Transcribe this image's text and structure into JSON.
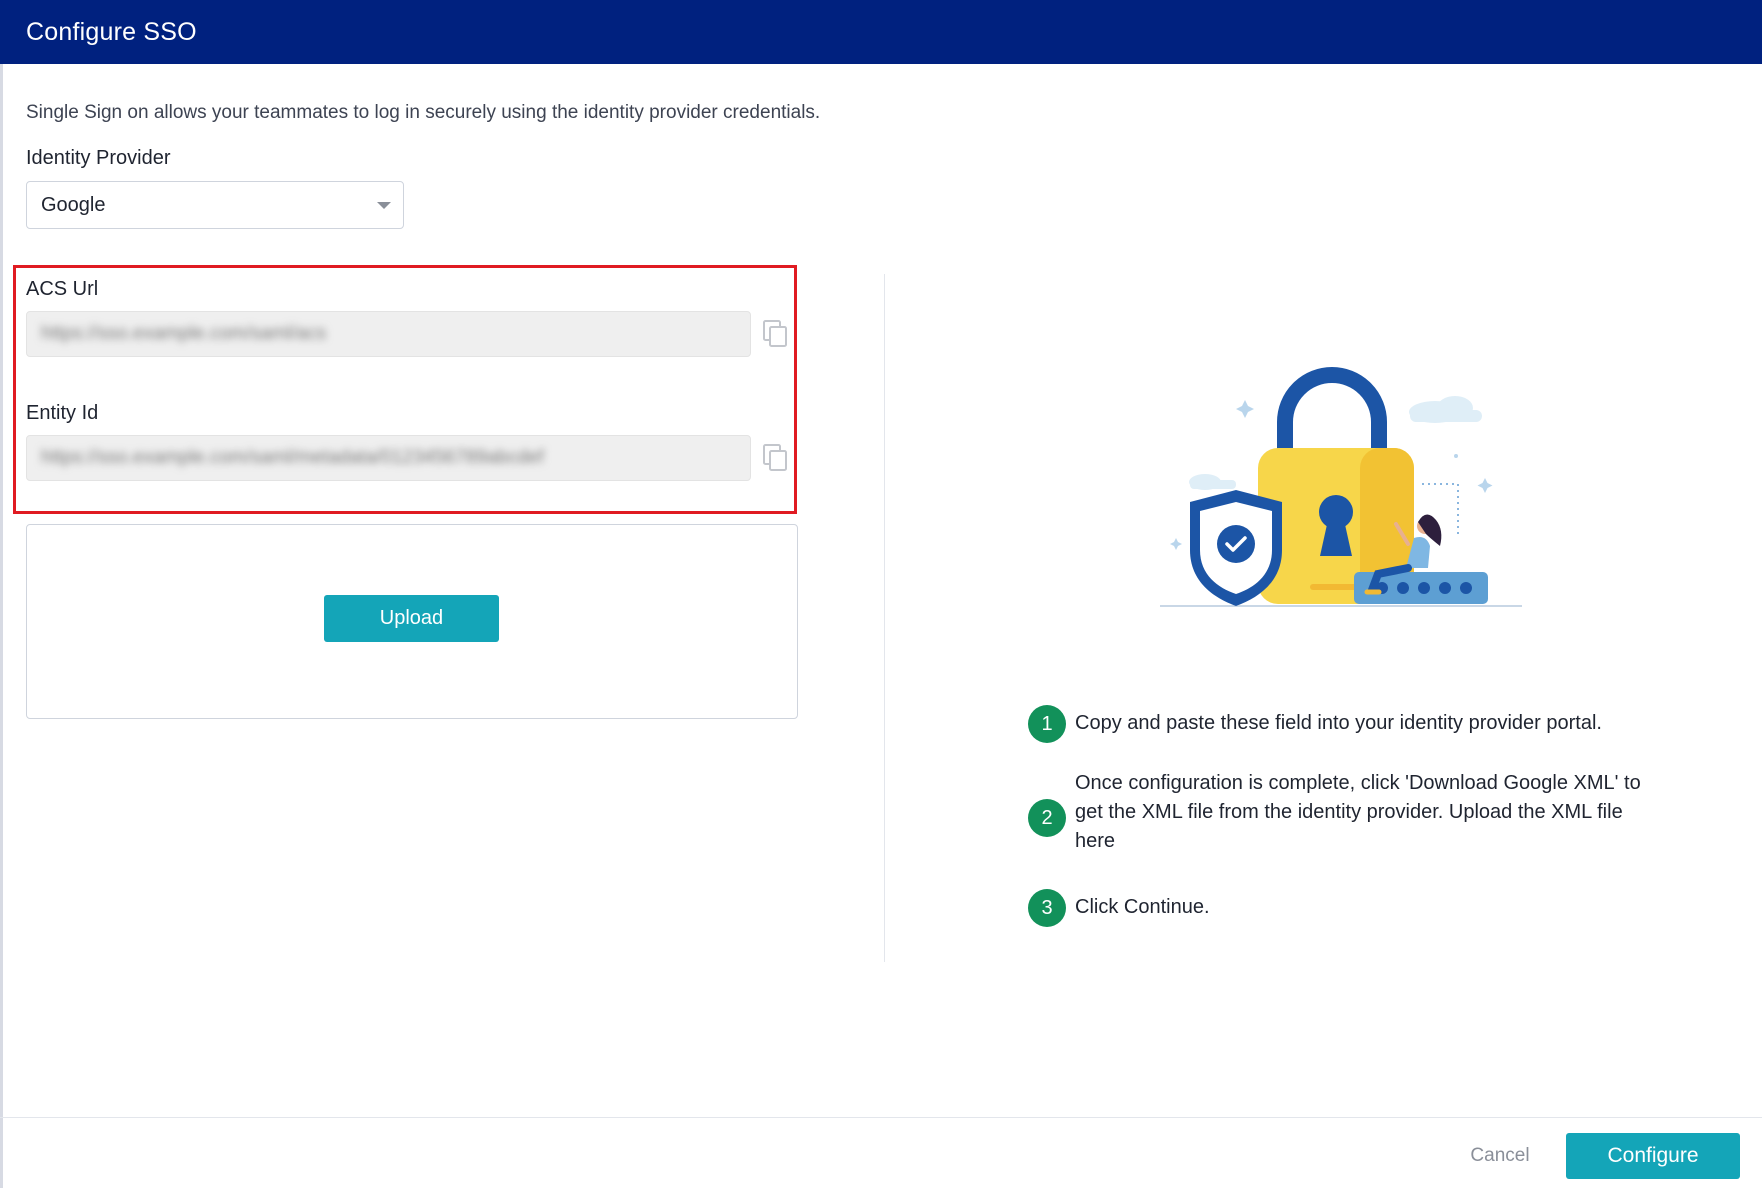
{
  "dialog": {
    "title": "Configure SSO",
    "intro": "Single Sign on allows your teammates to log in securely using the identity provider credentials."
  },
  "identity_provider": {
    "label": "Identity Provider",
    "selected": "Google"
  },
  "acs_url": {
    "label": "ACS Url",
    "value": "https://sso.example.com/saml/acs"
  },
  "entity_id": {
    "label": "Entity Id",
    "value": "https://sso.example.com/saml/metadata/0123456789abcdef"
  },
  "upload": {
    "button_label": "Upload"
  },
  "steps": [
    {
      "number": "1",
      "text": "Copy and paste these field into your identity provider portal."
    },
    {
      "number": "2",
      "text": "Once configuration is complete, click 'Download Google XML' to get the XML file from the identity provider. Upload the XML file here"
    },
    {
      "number": "3",
      "text": "Click Continue."
    }
  ],
  "footer": {
    "cancel_label": "Cancel",
    "configure_label": "Configure"
  },
  "colors": {
    "header": "#00217f",
    "accent": "#14a5b8",
    "step_badge": "#12915a",
    "highlight_border": "#e01b22"
  },
  "icons": {
    "copy": "copy-icon",
    "caret": "chevron-down-icon",
    "illustration": "lock-security-illustration"
  }
}
